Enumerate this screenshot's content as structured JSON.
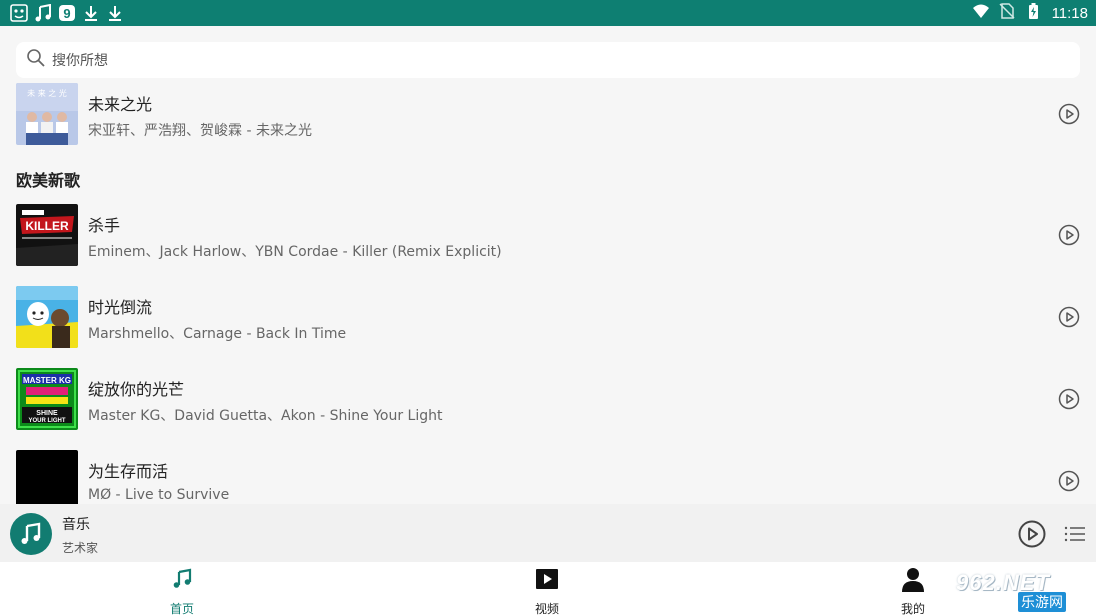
{
  "status_bar": {
    "time": "11:18",
    "left_icons": [
      "app-icon",
      "music-note-icon",
      "app-9-icon",
      "download-icon",
      "download-icon"
    ],
    "right_icons": [
      "wifi-icon",
      "no-sim-icon",
      "battery-charging-icon"
    ]
  },
  "search": {
    "placeholder": "搜你所想"
  },
  "songs_top": [
    {
      "title": "未来之光",
      "subtitle": "宋亚轩、严浩翔、贺峻霖 - 未来之光",
      "cover": "cover-weilaizhiguang"
    }
  ],
  "section": {
    "title": "欧美新歌"
  },
  "songs": [
    {
      "title": "杀手",
      "subtitle": "Eminem、Jack Harlow、YBN Cordae - Killer (Remix Explicit)",
      "cover": "cover-killer"
    },
    {
      "title": "时光倒流",
      "subtitle": "Marshmello、Carnage - Back In Time",
      "cover": "cover-back-in-time"
    },
    {
      "title": "绽放你的光芒",
      "subtitle": "Master KG、David Guetta、Akon - Shine Your Light",
      "cover": "cover-shine-your-light"
    },
    {
      "title": "为生存而活",
      "subtitle": "MØ - Live to Survive",
      "cover": "cover-live-to-survive"
    }
  ],
  "mini_player": {
    "title": "音乐",
    "artist": "艺术家"
  },
  "bottom_nav": {
    "tabs": [
      {
        "label": "首页",
        "icon": "music-note-icon",
        "active": true
      },
      {
        "label": "视频",
        "icon": "video-play-icon",
        "active": false
      },
      {
        "label": "我的",
        "icon": "person-icon",
        "active": false
      }
    ]
  },
  "watermark": {
    "top": "962.NET",
    "bottom": "乐游网"
  },
  "colors": {
    "accent": "#0e7f72",
    "background": "#f6f6f6",
    "text_primary": "#222222",
    "text_secondary": "#666666"
  }
}
